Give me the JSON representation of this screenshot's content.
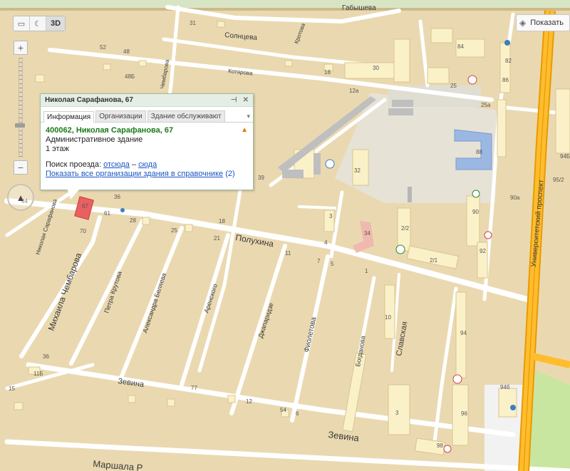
{
  "map": {
    "streets": [
      {
        "id": "solnceva",
        "label": "Солнцева"
      },
      {
        "id": "kodimov",
        "label": "Кротова"
      },
      {
        "id": "gabysheva",
        "label": "Габышева"
      },
      {
        "id": "kotyarova",
        "label": "Котярова"
      },
      {
        "id": "chembarova_top",
        "label": "Чембарова"
      },
      {
        "id": "polukhina",
        "label": "Полухина"
      },
      {
        "id": "zevina1",
        "label": "Зевина"
      },
      {
        "id": "zevina2",
        "label": "Зевина"
      },
      {
        "id": "marshala",
        "label": "Маршала Р"
      },
      {
        "id": "nik_sarafanova",
        "label": "Николая Сарафанова"
      },
      {
        "id": "mikh_chembarova",
        "label": "Михаила Чембарова"
      },
      {
        "id": "petra_krutova",
        "label": "Петра Крутова"
      },
      {
        "id": "alex_beljaeva",
        "label": "Александра Беляева"
      },
      {
        "id": "arenskogo",
        "label": "Аренского"
      },
      {
        "id": "dzhaparidze",
        "label": "Джапаридзе"
      },
      {
        "id": "fioletova",
        "label": "Фиолетова"
      },
      {
        "id": "bogdanova",
        "label": "Богданова"
      },
      {
        "id": "slavskaya",
        "label": "Славская"
      },
      {
        "id": "universitetsky",
        "label": "Университетский проспект"
      }
    ],
    "house_numbers": [
      "31",
      "52",
      "48",
      "48Б",
      "18",
      "30",
      "12а",
      "84",
      "82",
      "86",
      "25",
      "25а",
      "88",
      "94Б",
      "95/2",
      "90а",
      "90",
      "92",
      "2/2",
      "2/1",
      "34",
      "3",
      "4",
      "5",
      "1",
      "10",
      "94",
      "96",
      "98",
      "94б",
      "3",
      "11",
      "7",
      "12",
      "54",
      "6",
      "21",
      "25",
      "28",
      "61",
      "70",
      "67",
      "36",
      "44",
      "39",
      "32",
      "36",
      "11Б",
      "15",
      "77",
      "18"
    ]
  },
  "toolbar": {
    "ruler_icon": "ruler-icon",
    "traffic_icon": "traffic-icon",
    "mode_3d": "3D"
  },
  "zoom": {
    "plus": "+",
    "minus": "−",
    "level": 0.35
  },
  "compass": {
    "north": "▲"
  },
  "layers_button": {
    "label": "Показать",
    "icon": "layers-icon"
  },
  "balloon": {
    "title": "Николая Сарафанова, 67",
    "tabs": [
      "Информация",
      "Организации",
      "Здание обслуживают"
    ],
    "address": "400062, Николая Сарафанова, 67",
    "type": "Административное здание",
    "floors": "1 этаж",
    "route_label": "Поиск проезда:",
    "route_from": "отсюда",
    "route_dash": "–",
    "route_to": "сюда",
    "orgs_link": "Показать все организации здания в справочнике",
    "orgs_count": "(2)"
  },
  "colors": {
    "land": "#ead9b0",
    "road": "#ffffff",
    "highway": "#f5a400",
    "park": "#c9e6a0",
    "selected_building": "#e86060",
    "balloon_border": "#9fbfa5",
    "address_green": "#1a7a1a",
    "link_blue": "#1a56c4"
  }
}
